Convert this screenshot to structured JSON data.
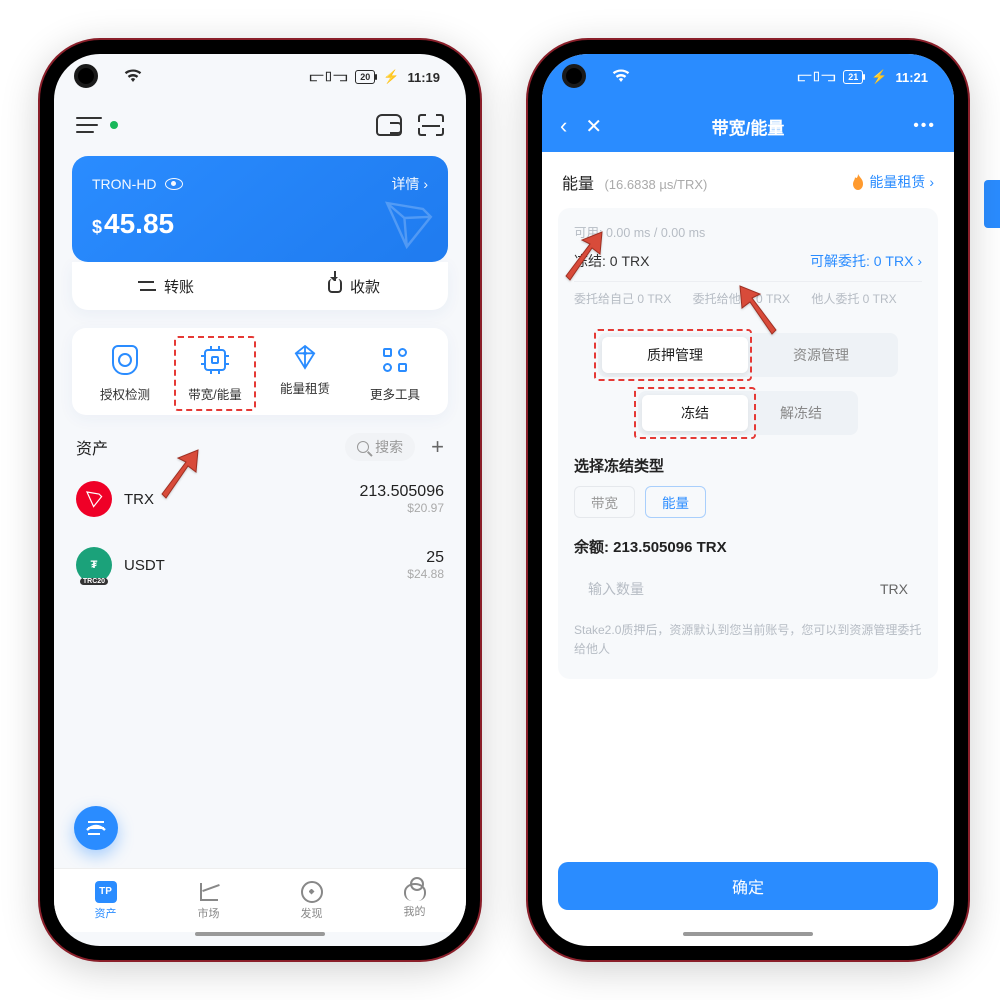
{
  "phone1": {
    "status_time": "11:19",
    "status_battery": "20",
    "wallet_name": "TRON-HD",
    "details_link": "详情",
    "currency_symbol": "$",
    "balance": "45.85",
    "action_transfer": "转账",
    "action_receive": "收款",
    "tools": {
      "auth_check": "授权检测",
      "bandwidth_energy": "带宽/能量",
      "energy_rental": "能量租赁",
      "more_tools": "更多工具"
    },
    "assets_label": "资产",
    "search_placeholder": "搜索",
    "assets": [
      {
        "symbol": "TRX",
        "amount": "213.505096",
        "fiat": "$20.97"
      },
      {
        "symbol": "USDT",
        "amount": "25",
        "fiat": "$24.88"
      }
    ],
    "tabs": {
      "assets": "资产",
      "market": "市场",
      "discover": "发现",
      "mine": "我的"
    }
  },
  "phone2": {
    "status_time": "11:21",
    "status_battery": "21",
    "page_title": "带宽/能量",
    "energy_label": "能量",
    "energy_rate": "(16.6838 µs/TRX)",
    "rental_link": "能量租赁",
    "available_label": "可用: 0.00 ms / 0.00 ms",
    "frozen_label": "冻结: 0 TRX",
    "delegatable_label": "可解委托: 0 TRX",
    "delegate_self": "委托给自己 0 TRX",
    "delegate_others": "委托给他人 0 TRX",
    "others_delegate": "他人委托 0 TRX",
    "seg1_stake_mgmt": "质押管理",
    "seg1_res_mgmt": "资源管理",
    "seg2_freeze": "冻结",
    "seg2_unfreeze": "解冻结",
    "freeze_type_title": "选择冻结类型",
    "pill_bandwidth": "带宽",
    "pill_energy": "能量",
    "balance_label": "余额: 213.505096 TRX",
    "input_placeholder": "输入数量",
    "input_unit": "TRX",
    "note": "Stake2.0质押后，资源默认到您当前账号，您可以到资源管理委托给他人",
    "confirm_btn": "确定"
  }
}
